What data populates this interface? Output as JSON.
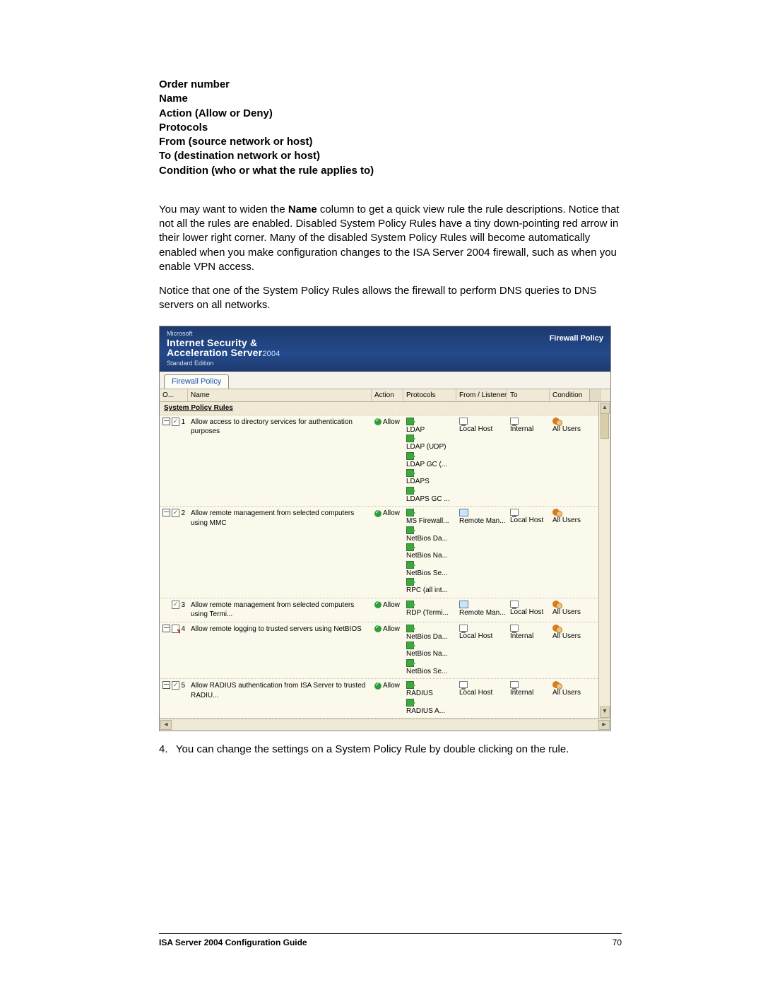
{
  "doc": {
    "columns_list": [
      "Order number",
      "Name",
      "Action (Allow or Deny)",
      "Protocols",
      "From (source network or host)",
      "To (destination network or host)",
      "Condition (who or what the rule applies to)"
    ],
    "para1_pre": "You may want to widen the ",
    "para1_bold": "Name",
    "para1_post": " column to get a quick view rule the rule descriptions. Notice that not all the rules are enabled. Disabled System Policy Rules have a tiny down-pointing red arrow in their lower right corner. Many of the disabled System Policy Rules will become automatically enabled when you make configuration changes to the ISA Server 2004 firewall, such as when you enable VPN access.",
    "para2": "Notice that one of the System Policy Rules allows the firewall to perform DNS queries to DNS servers on all networks.",
    "step4_num": "4.",
    "step4_text": "You can change the settings on a System Policy Rule by double clicking on the rule.",
    "footer_title": "ISA Server 2004 Configuration Guide",
    "page_number": "70"
  },
  "shot": {
    "brand_top": "Microsoft",
    "brand": "Internet Security &\nAcceleration Server",
    "brand_year": "2004",
    "brand_edition": "Standard Edition",
    "header_right": "Firewall Policy",
    "tab_label": "Firewall Policy",
    "columns": {
      "order": "O...",
      "name": "Name",
      "action": "Action",
      "protocols": "Protocols",
      "from": "From / Listener",
      "to": "To",
      "condition": "Condition"
    },
    "section_title": "System Policy Rules",
    "rows": [
      {
        "order": "1",
        "expandable": true,
        "status": "enabled",
        "name": "Allow access to directory services for authentication purposes",
        "action": "Allow",
        "protocols": [
          "LDAP",
          "LDAP (UDP)",
          "LDAP GC (...",
          "LDAPS",
          "LDAPS GC ..."
        ],
        "from": [
          {
            "icon": "host",
            "text": "Local Host"
          }
        ],
        "to": [
          {
            "icon": "host",
            "text": "Internal"
          }
        ],
        "condition": "All Users"
      },
      {
        "order": "2",
        "expandable": true,
        "status": "enabled",
        "name": "Allow remote management from selected computers using MMC",
        "action": "Allow",
        "protocols": [
          "MS Firewall...",
          "NetBios Da...",
          "NetBios Na...",
          "NetBios Se...",
          "RPC (all int..."
        ],
        "from": [
          {
            "icon": "compset",
            "text": "Remote Man..."
          }
        ],
        "to": [
          {
            "icon": "host",
            "text": "Local Host"
          }
        ],
        "condition": "All Users"
      },
      {
        "order": "3",
        "expandable": false,
        "status": "enabled",
        "name": "Allow remote management from selected computers using Termi...",
        "action": "Allow",
        "protocols": [
          "RDP (Termi..."
        ],
        "from": [
          {
            "icon": "compset",
            "text": "Remote Man..."
          }
        ],
        "to": [
          {
            "icon": "host",
            "text": "Local Host"
          }
        ],
        "condition": "All Users"
      },
      {
        "order": "4",
        "expandable": true,
        "status": "disabled",
        "name": "Allow remote logging to trusted servers using NetBIOS",
        "action": "Allow",
        "protocols": [
          "NetBios Da...",
          "NetBios Na...",
          "NetBios Se..."
        ],
        "from": [
          {
            "icon": "host",
            "text": "Local Host"
          }
        ],
        "to": [
          {
            "icon": "host",
            "text": "Internal"
          }
        ],
        "condition": "All Users"
      },
      {
        "order": "5",
        "expandable": true,
        "status": "enabled",
        "name": "Allow RADIUS authentication from ISA Server to trusted RADIU...",
        "action": "Allow",
        "protocols": [
          "RADIUS",
          "RADIUS A..."
        ],
        "from": [
          {
            "icon": "host",
            "text": "Local Host"
          }
        ],
        "to": [
          {
            "icon": "host",
            "text": "Internal"
          }
        ],
        "condition": "All Users"
      }
    ]
  }
}
